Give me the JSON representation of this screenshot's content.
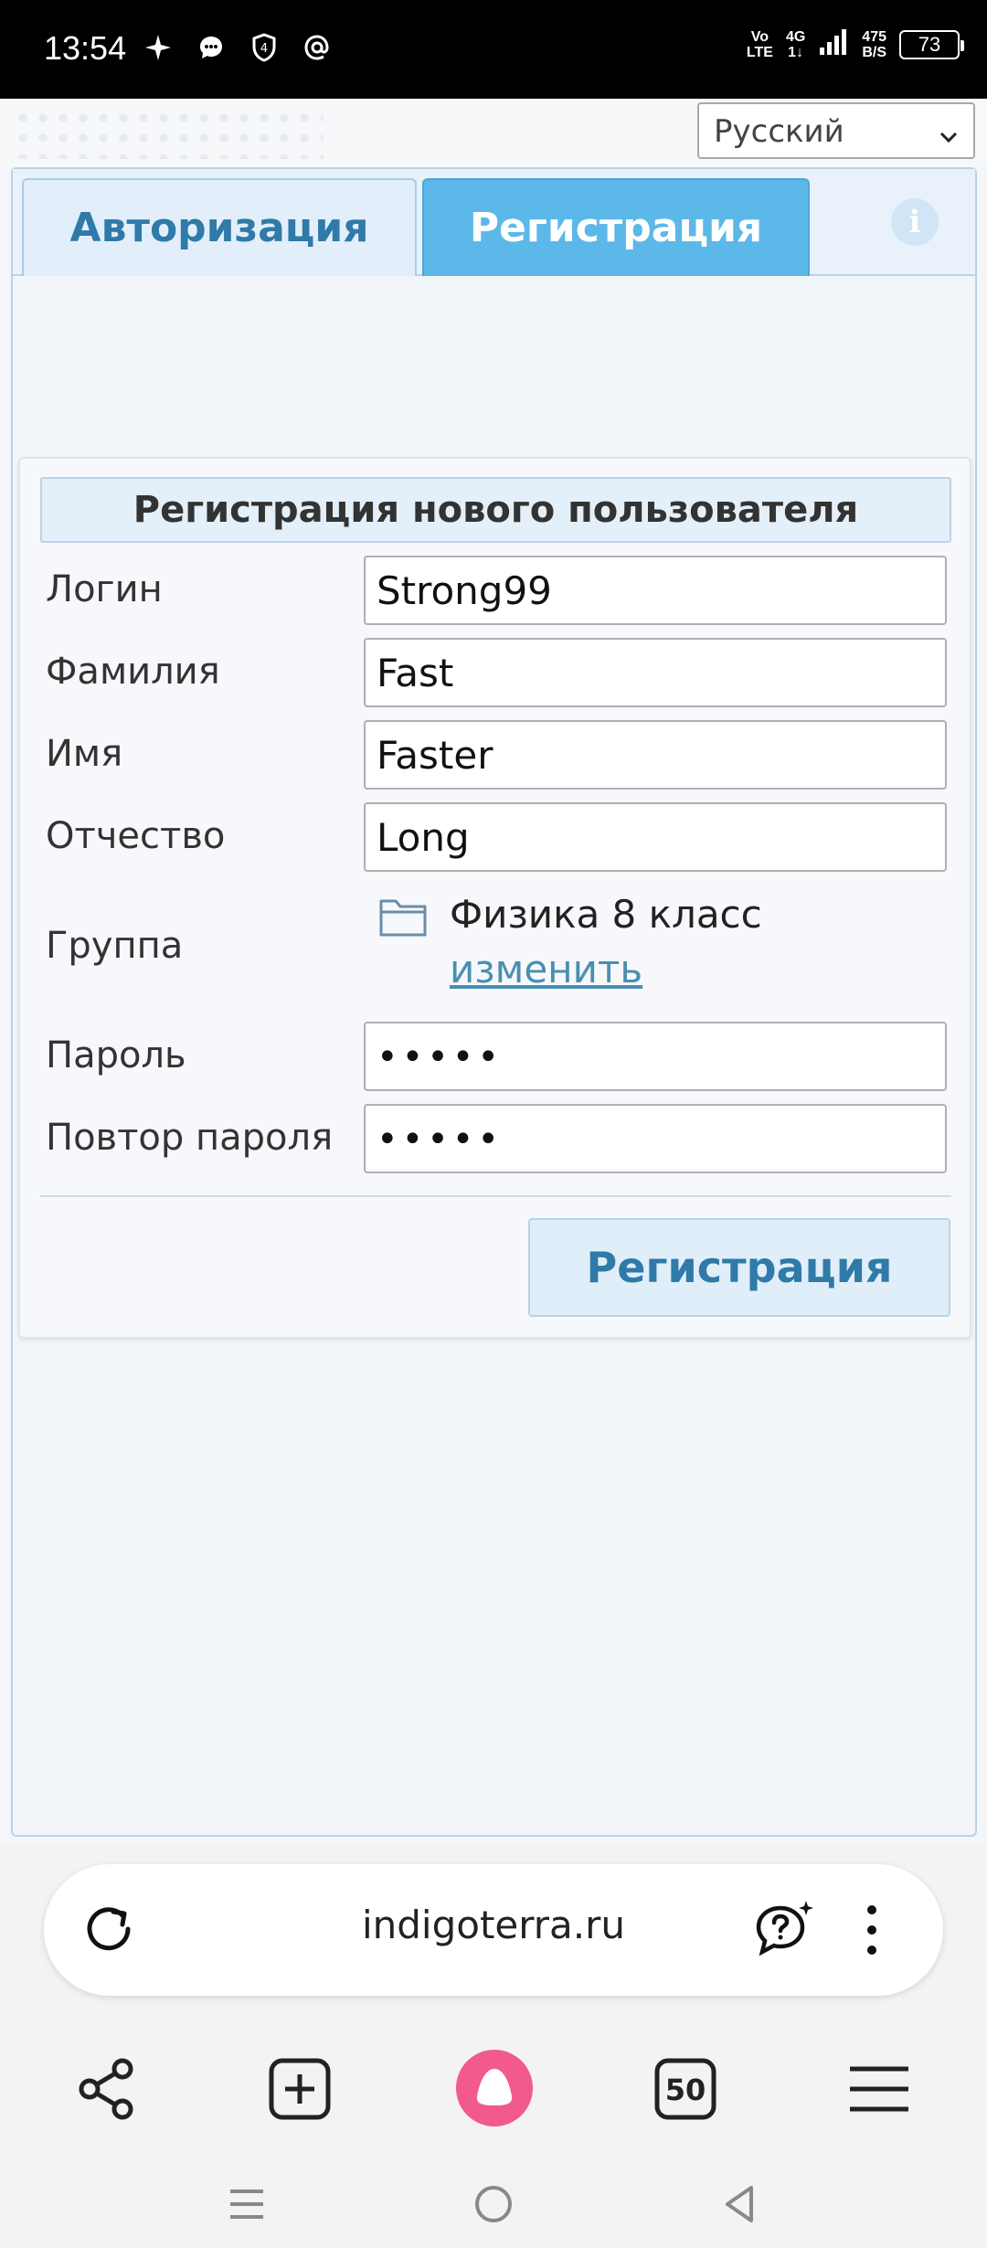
{
  "status_bar": {
    "time": "13:54",
    "network_top": "Vo",
    "network_bottom": "LTE",
    "gen_top": "4G",
    "gen_bottom": "1↓",
    "speed_value": "475",
    "speed_unit": "B/S",
    "battery": "73"
  },
  "language_select": {
    "value": "Русский"
  },
  "tabs": [
    {
      "label": "Авторизация",
      "active": false
    },
    {
      "label": "Регистрация",
      "active": true
    }
  ],
  "form": {
    "title": "Регистрация нового пользователя",
    "fields": {
      "login": {
        "label": "Логин",
        "value": "Strong99"
      },
      "lastname": {
        "label": "Фамилия",
        "value": "Fast"
      },
      "firstname": {
        "label": "Имя",
        "value": "Faster"
      },
      "patronymic": {
        "label": "Отчество",
        "value": "Long"
      },
      "group": {
        "label": "Группа",
        "value": "Физика 8 класс",
        "change_link": "изменить"
      },
      "password": {
        "label": "Пароль",
        "value": "•••••"
      },
      "password_repeat": {
        "label": "Повтор пароля",
        "value": "•••••"
      }
    },
    "submit_label": "Регистрация"
  },
  "browser": {
    "url": "indigoterra.ru",
    "tabs_count": "50"
  },
  "colors": {
    "accent": "#5cb8e8",
    "accent_text": "#2f7aa8",
    "alice": "#f25a8e"
  }
}
